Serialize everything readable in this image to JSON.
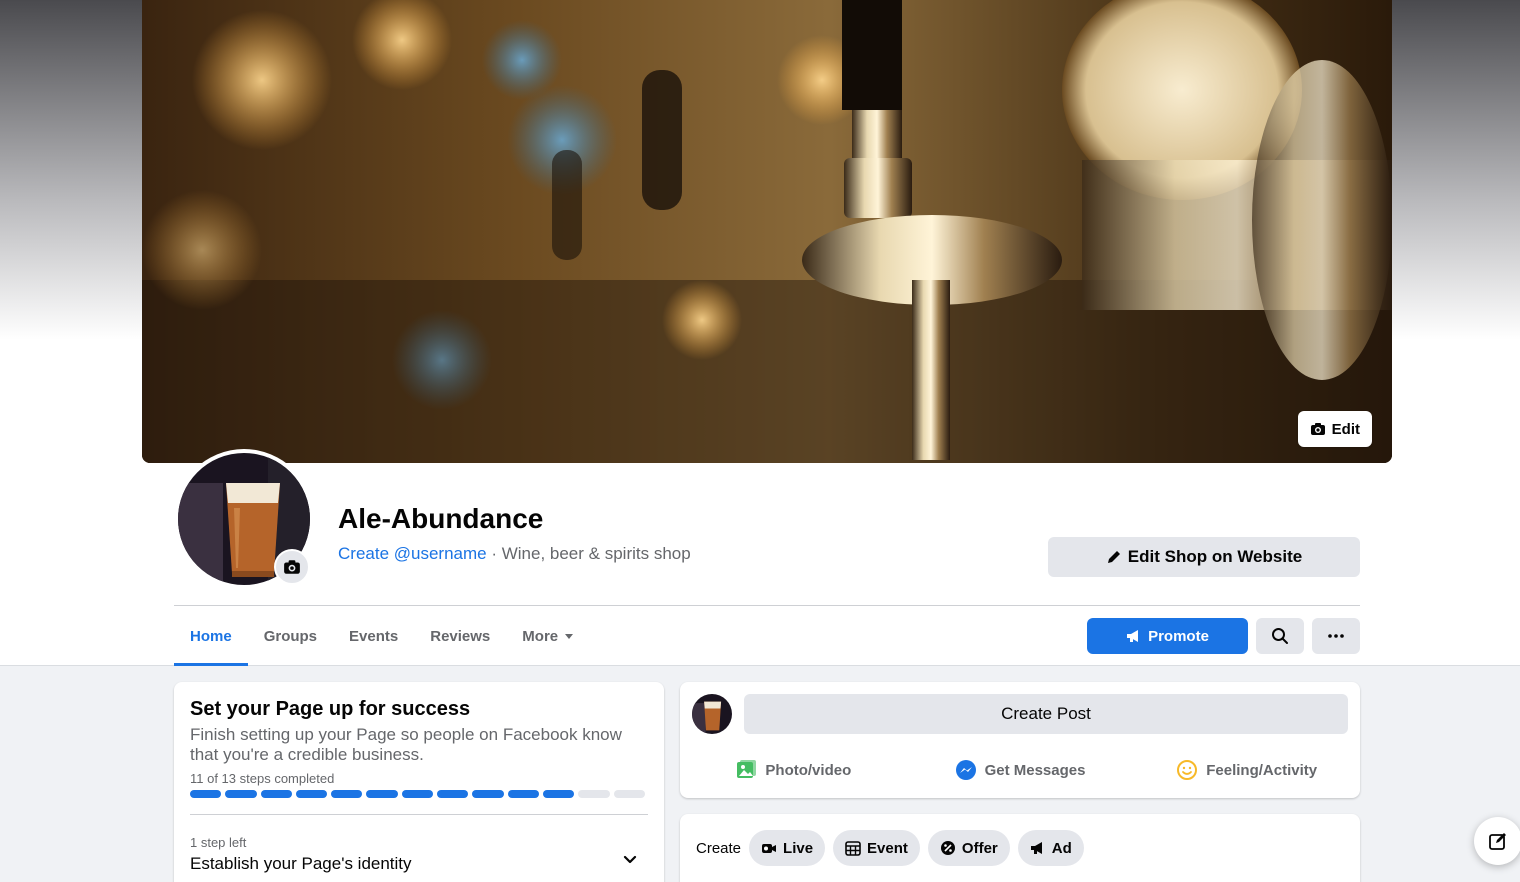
{
  "cover": {
    "edit_label": "Edit"
  },
  "page": {
    "name": "Ale-Abundance",
    "username_link": "Create @username",
    "separator": " · ",
    "category": "Wine, beer & spirits shop",
    "edit_shop_label": "Edit Shop on Website"
  },
  "tabs": [
    {
      "label": "Home",
      "active": true
    },
    {
      "label": "Groups"
    },
    {
      "label": "Events"
    },
    {
      "label": "Reviews"
    },
    {
      "label": "More"
    }
  ],
  "actions": {
    "promote_label": "Promote"
  },
  "setup": {
    "title": "Set your Page up for success",
    "description": "Finish setting up your Page so people on Facebook know that you're a credible business.",
    "steps_text": "11 of 13 steps completed",
    "steps_completed": 11,
    "steps_total": 13,
    "step_left": "1 step left",
    "step_title": "Establish your Page's identity"
  },
  "post": {
    "create_label": "Create Post",
    "actions": [
      {
        "label": "Photo/video",
        "icon": "photo-icon"
      },
      {
        "label": "Get Messages",
        "icon": "messenger-icon"
      },
      {
        "label": "Feeling/Activity",
        "icon": "smiley-icon"
      }
    ]
  },
  "create": {
    "label": "Create",
    "items": [
      {
        "label": "Live",
        "icon": "video-icon"
      },
      {
        "label": "Event",
        "icon": "calendar-icon"
      },
      {
        "label": "Offer",
        "icon": "offer-icon"
      },
      {
        "label": "Ad",
        "icon": "megaphone-icon"
      }
    ]
  },
  "colors": {
    "accent": "#1b74e4",
    "background": "#f0f2f5",
    "button_grey": "#e4e6eb"
  }
}
